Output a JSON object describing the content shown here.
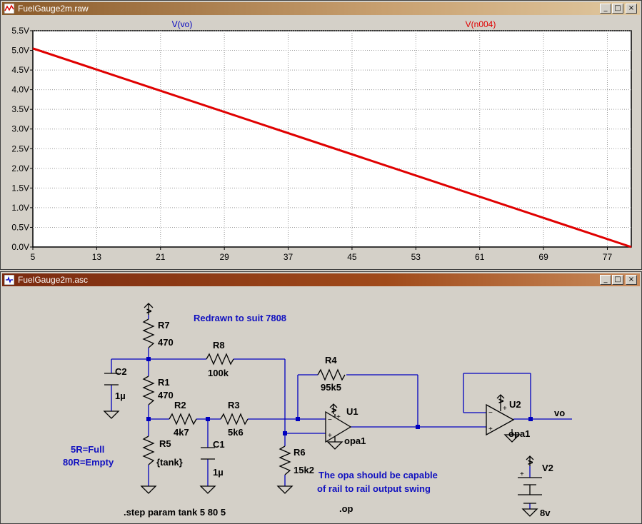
{
  "plot_window": {
    "title": "FuelGauge2m.raw",
    "buttons": {
      "minimize": "_",
      "maximize": "□",
      "close": "×"
    }
  },
  "schematic_window": {
    "title": "FuelGauge2m.asc",
    "buttons": {
      "minimize": "_",
      "maximize": "□",
      "close": "×"
    }
  },
  "chart_data": {
    "type": "line",
    "series": [
      {
        "name": "V(vo)",
        "color": "#0000c0",
        "x": [],
        "y": []
      },
      {
        "name": "V(n004)",
        "color": "#e00000",
        "x": [
          5,
          80
        ],
        "y": [
          5.05,
          0.0
        ]
      }
    ],
    "xlim": [
      5,
      80
    ],
    "ylim": [
      0,
      5.5
    ],
    "xticks": [
      "5",
      "13",
      "21",
      "29",
      "37",
      "45",
      "53",
      "61",
      "69",
      "77"
    ],
    "xtick_values": [
      5,
      13,
      21,
      29,
      37,
      45,
      53,
      61,
      69,
      77
    ],
    "yticks": [
      "0.0V",
      "0.5V",
      "1.0V",
      "1.5V",
      "2.0V",
      "2.5V",
      "3.0V",
      "3.5V",
      "4.0V",
      "4.5V",
      "5.0V",
      "5.5V"
    ],
    "ytick_values": [
      0,
      0.5,
      1,
      1.5,
      2,
      2.5,
      3,
      3.5,
      4,
      4.5,
      5,
      5.5
    ],
    "grid": true
  },
  "schematic": {
    "components": {
      "R7": {
        "name": "R7",
        "value": "470"
      },
      "R8": {
        "name": "R8",
        "value": "100k"
      },
      "R1": {
        "name": "R1",
        "value": "470"
      },
      "R2": {
        "name": "R2",
        "value": "4k7"
      },
      "R3": {
        "name": "R3",
        "value": "5k6"
      },
      "R4": {
        "name": "R4",
        "value": "95k5"
      },
      "R5": {
        "name": "R5",
        "value": "{tank}"
      },
      "R6": {
        "name": "R6",
        "value": "15k2"
      },
      "C1": {
        "name": "C1",
        "value": "1µ"
      },
      "C2": {
        "name": "C2",
        "value": "1µ"
      },
      "U1": {
        "name": "U1",
        "model": "opa1"
      },
      "U2": {
        "name": "U2",
        "model": "opa1"
      },
      "V2": {
        "name": "V2",
        "value": "8v"
      }
    },
    "supply_label": "v",
    "output_label": "vo",
    "notes": {
      "redrawn": "Redrawn to suit 7808",
      "full": "5R=Full",
      "empty": "80R=Empty",
      "opa_line1": "The opa should be capable",
      "opa_line2": "of rail to rail output swing",
      "step": ".step param tank 5 80 5",
      "op": ".op"
    },
    "colors": {
      "wire": "#0000c0",
      "component": "#000000",
      "note": "#1010c0"
    }
  }
}
